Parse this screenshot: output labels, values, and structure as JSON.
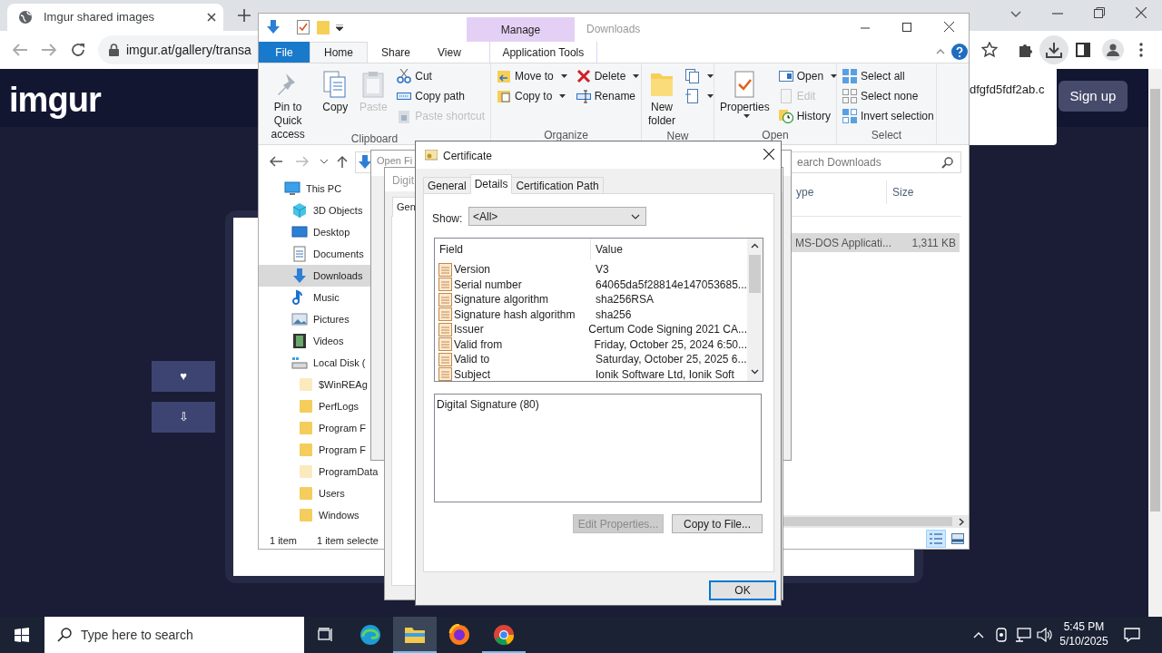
{
  "browser": {
    "tab_title": "Imgur shared images",
    "address": "imgur.at/gallery/transa",
    "download_bubble": "dfgfd5fdf2ab.c"
  },
  "page": {
    "logo": "imgur",
    "sign_up": "Sign up",
    "side_buttons": [
      "♥",
      "⇩"
    ]
  },
  "explorer": {
    "title": "Downloads",
    "context_label": "Manage",
    "tabs": [
      {
        "label": "File",
        "kind": "file",
        "selected": false
      },
      {
        "label": "Home",
        "kind": "tab",
        "selected": true
      },
      {
        "label": "Share",
        "kind": "tab",
        "selected": false
      },
      {
        "label": "View",
        "kind": "tab",
        "selected": false
      },
      {
        "label": "Application Tools",
        "kind": "context",
        "selected": false
      }
    ],
    "ribbon_groups": [
      {
        "label": "Clipboard",
        "columns": [
          {
            "kind": "large",
            "items": [
              {
                "label": "Pin to Quick access",
                "disabled": false,
                "dropdown": false
              }
            ]
          },
          {
            "kind": "large",
            "items": [
              {
                "label": "Copy",
                "disabled": false,
                "dropdown": false
              }
            ]
          },
          {
            "kind": "large",
            "items": [
              {
                "label": "Paste",
                "disabled": true,
                "dropdown": false
              }
            ]
          },
          {
            "kind": "small",
            "items": [
              {
                "label": "Cut",
                "disabled": false,
                "dropdown": false
              },
              {
                "label": "Copy path",
                "disabled": false,
                "dropdown": false
              },
              {
                "label": "Paste shortcut",
                "disabled": true,
                "dropdown": false
              }
            ]
          }
        ]
      },
      {
        "label": "Organize",
        "columns": [
          {
            "kind": "small",
            "items": [
              {
                "label": "Move to",
                "disabled": false,
                "dropdown": true
              },
              {
                "label": "Copy to",
                "disabled": false,
                "dropdown": true
              }
            ]
          },
          {
            "kind": "small",
            "items": [
              {
                "label": "Delete",
                "disabled": false,
                "dropdown": true
              },
              {
                "label": "Rename",
                "disabled": false,
                "dropdown": false
              }
            ]
          }
        ]
      },
      {
        "label": "New",
        "columns": [
          {
            "kind": "large",
            "items": [
              {
                "label": "New folder",
                "disabled": false,
                "dropdown": false
              }
            ]
          },
          {
            "kind": "small",
            "items": [
              {
                "disabled": false,
                "dropdown": true
              },
              {
                "disabled": false,
                "dropdown": true
              }
            ]
          }
        ]
      },
      {
        "label": "Open",
        "columns": [
          {
            "kind": "large",
            "items": [
              {
                "label": "Properties",
                "disabled": false,
                "dropdown": true
              }
            ]
          },
          {
            "kind": "small",
            "items": [
              {
                "label": "Open",
                "disabled": false,
                "dropdown": true
              },
              {
                "label": "Edit",
                "disabled": true,
                "dropdown": false
              },
              {
                "label": "History",
                "disabled": false,
                "dropdown": false
              }
            ]
          }
        ]
      },
      {
        "label": "Select",
        "columns": [
          {
            "kind": "small",
            "items": [
              {
                "label": "Select all",
                "disabled": false,
                "dropdown": false
              },
              {
                "label": "Select none",
                "disabled": false,
                "dropdown": false
              },
              {
                "label": "Invert selection",
                "disabled": false,
                "dropdown": false
              }
            ]
          }
        ]
      }
    ],
    "search_placeholder": "earch Downloads",
    "nav_tree": [
      {
        "label": "This PC",
        "selected": false,
        "hidden": false,
        "children": [
          {
            "label": "3D Objects",
            "selected": false,
            "hidden": false
          },
          {
            "label": "Desktop",
            "selected": false,
            "hidden": false
          },
          {
            "label": "Documents",
            "selected": false,
            "hidden": false
          },
          {
            "label": "Downloads",
            "selected": true,
            "hidden": false
          },
          {
            "label": "Music",
            "selected": false,
            "hidden": false
          },
          {
            "label": "Pictures",
            "selected": false,
            "hidden": false
          },
          {
            "label": "Videos",
            "selected": false,
            "hidden": false
          },
          {
            "label": "Local Disk (",
            "selected": false,
            "hidden": false,
            "children": [
              {
                "label": "$WinREAg",
                "selected": false,
                "hidden": true
              },
              {
                "label": "PerfLogs",
                "selected": false,
                "hidden": false
              },
              {
                "label": "Program F",
                "selected": false,
                "hidden": false
              },
              {
                "label": "Program F",
                "selected": false,
                "hidden": false
              },
              {
                "label": "ProgramData",
                "selected": false,
                "hidden": true
              },
              {
                "label": "Users",
                "selected": false,
                "hidden": false
              },
              {
                "label": "Windows",
                "selected": false,
                "hidden": false
              }
            ]
          }
        ]
      }
    ],
    "columns": [
      "ype",
      "Size"
    ],
    "rows": [
      {
        "cells": [
          "MS-DOS Applicati...",
          "1,311 KB"
        ],
        "selected": true
      }
    ],
    "status": [
      "1 item",
      "1 item selecte"
    ],
    "view_buttons": [
      {
        "selected": true
      },
      {
        "selected": false
      }
    ]
  },
  "open_file_dialog": {
    "title": "Open Fi"
  },
  "signature_dialog": {
    "title": "Digit",
    "tab": "Gen"
  },
  "certificate": {
    "title": "Certificate",
    "tabs": [
      {
        "label": "General",
        "selected": false
      },
      {
        "label": "Details",
        "selected": true
      },
      {
        "label": "Certification Path",
        "selected": false
      }
    ],
    "show_label": "Show:",
    "show_value": "<All>",
    "columns": [
      "Field",
      "Value"
    ],
    "rows": [
      {
        "field": "Version",
        "value": "V3",
        "selected": false
      },
      {
        "field": "Serial number",
        "value": "64065da5f28814e147053685...",
        "selected": false
      },
      {
        "field": "Signature algorithm",
        "value": "sha256RSA",
        "selected": false
      },
      {
        "field": "Signature hash algorithm",
        "value": "sha256",
        "selected": false
      },
      {
        "field": "Issuer",
        "value": "Certum Code Signing 2021 CA...",
        "selected": false
      },
      {
        "field": "Valid from",
        "value": "Friday, October 25, 2024 6:50...",
        "selected": false
      },
      {
        "field": "Valid to",
        "value": "Saturday, October 25, 2025 6...",
        "selected": false
      },
      {
        "field": "Subject",
        "value": "Ionik Software Ltd, Ionik Soft",
        "selected": false
      }
    ],
    "detail_text": "Digital Signature (80)",
    "buttons": [
      {
        "label": "Edit Properties...",
        "disabled": true
      },
      {
        "label": "Copy to File...",
        "disabled": false
      }
    ],
    "ok": "OK"
  },
  "taskbar": {
    "search_placeholder": "Type here to search",
    "apps": [
      {
        "selected": false,
        "running": false
      },
      {
        "selected": false,
        "running": false
      },
      {
        "selected": true,
        "running": true
      },
      {
        "selected": false,
        "running": false
      },
      {
        "selected": false,
        "running": true
      }
    ],
    "time": "5:45 PM",
    "date": "5/10/2025"
  }
}
